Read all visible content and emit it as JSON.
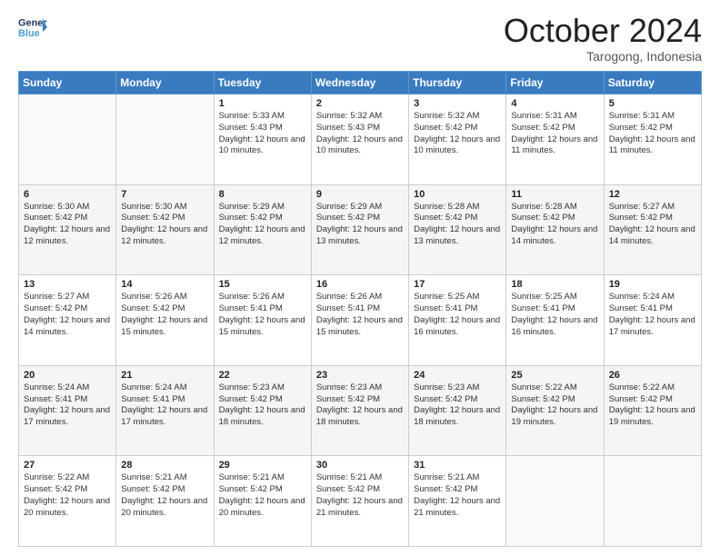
{
  "logo": {
    "line1": "General",
    "line2": "Blue"
  },
  "header": {
    "month": "October 2024",
    "location": "Tarogong, Indonesia"
  },
  "weekdays": [
    "Sunday",
    "Monday",
    "Tuesday",
    "Wednesday",
    "Thursday",
    "Friday",
    "Saturday"
  ],
  "weeks": [
    [
      {
        "day": "",
        "info": ""
      },
      {
        "day": "",
        "info": ""
      },
      {
        "day": "1",
        "info": "Sunrise: 5:33 AM\nSunset: 5:43 PM\nDaylight: 12 hours and 10 minutes."
      },
      {
        "day": "2",
        "info": "Sunrise: 5:32 AM\nSunset: 5:43 PM\nDaylight: 12 hours and 10 minutes."
      },
      {
        "day": "3",
        "info": "Sunrise: 5:32 AM\nSunset: 5:42 PM\nDaylight: 12 hours and 10 minutes."
      },
      {
        "day": "4",
        "info": "Sunrise: 5:31 AM\nSunset: 5:42 PM\nDaylight: 12 hours and 11 minutes."
      },
      {
        "day": "5",
        "info": "Sunrise: 5:31 AM\nSunset: 5:42 PM\nDaylight: 12 hours and 11 minutes."
      }
    ],
    [
      {
        "day": "6",
        "info": "Sunrise: 5:30 AM\nSunset: 5:42 PM\nDaylight: 12 hours and 12 minutes."
      },
      {
        "day": "7",
        "info": "Sunrise: 5:30 AM\nSunset: 5:42 PM\nDaylight: 12 hours and 12 minutes."
      },
      {
        "day": "8",
        "info": "Sunrise: 5:29 AM\nSunset: 5:42 PM\nDaylight: 12 hours and 12 minutes."
      },
      {
        "day": "9",
        "info": "Sunrise: 5:29 AM\nSunset: 5:42 PM\nDaylight: 12 hours and 13 minutes."
      },
      {
        "day": "10",
        "info": "Sunrise: 5:28 AM\nSunset: 5:42 PM\nDaylight: 12 hours and 13 minutes."
      },
      {
        "day": "11",
        "info": "Sunrise: 5:28 AM\nSunset: 5:42 PM\nDaylight: 12 hours and 14 minutes."
      },
      {
        "day": "12",
        "info": "Sunrise: 5:27 AM\nSunset: 5:42 PM\nDaylight: 12 hours and 14 minutes."
      }
    ],
    [
      {
        "day": "13",
        "info": "Sunrise: 5:27 AM\nSunset: 5:42 PM\nDaylight: 12 hours and 14 minutes."
      },
      {
        "day": "14",
        "info": "Sunrise: 5:26 AM\nSunset: 5:42 PM\nDaylight: 12 hours and 15 minutes."
      },
      {
        "day": "15",
        "info": "Sunrise: 5:26 AM\nSunset: 5:41 PM\nDaylight: 12 hours and 15 minutes."
      },
      {
        "day": "16",
        "info": "Sunrise: 5:26 AM\nSunset: 5:41 PM\nDaylight: 12 hours and 15 minutes."
      },
      {
        "day": "17",
        "info": "Sunrise: 5:25 AM\nSunset: 5:41 PM\nDaylight: 12 hours and 16 minutes."
      },
      {
        "day": "18",
        "info": "Sunrise: 5:25 AM\nSunset: 5:41 PM\nDaylight: 12 hours and 16 minutes."
      },
      {
        "day": "19",
        "info": "Sunrise: 5:24 AM\nSunset: 5:41 PM\nDaylight: 12 hours and 17 minutes."
      }
    ],
    [
      {
        "day": "20",
        "info": "Sunrise: 5:24 AM\nSunset: 5:41 PM\nDaylight: 12 hours and 17 minutes."
      },
      {
        "day": "21",
        "info": "Sunrise: 5:24 AM\nSunset: 5:41 PM\nDaylight: 12 hours and 17 minutes."
      },
      {
        "day": "22",
        "info": "Sunrise: 5:23 AM\nSunset: 5:42 PM\nDaylight: 12 hours and 18 minutes."
      },
      {
        "day": "23",
        "info": "Sunrise: 5:23 AM\nSunset: 5:42 PM\nDaylight: 12 hours and 18 minutes."
      },
      {
        "day": "24",
        "info": "Sunrise: 5:23 AM\nSunset: 5:42 PM\nDaylight: 12 hours and 18 minutes."
      },
      {
        "day": "25",
        "info": "Sunrise: 5:22 AM\nSunset: 5:42 PM\nDaylight: 12 hours and 19 minutes."
      },
      {
        "day": "26",
        "info": "Sunrise: 5:22 AM\nSunset: 5:42 PM\nDaylight: 12 hours and 19 minutes."
      }
    ],
    [
      {
        "day": "27",
        "info": "Sunrise: 5:22 AM\nSunset: 5:42 PM\nDaylight: 12 hours and 20 minutes."
      },
      {
        "day": "28",
        "info": "Sunrise: 5:21 AM\nSunset: 5:42 PM\nDaylight: 12 hours and 20 minutes."
      },
      {
        "day": "29",
        "info": "Sunrise: 5:21 AM\nSunset: 5:42 PM\nDaylight: 12 hours and 20 minutes."
      },
      {
        "day": "30",
        "info": "Sunrise: 5:21 AM\nSunset: 5:42 PM\nDaylight: 12 hours and 21 minutes."
      },
      {
        "day": "31",
        "info": "Sunrise: 5:21 AM\nSunset: 5:42 PM\nDaylight: 12 hours and 21 minutes."
      },
      {
        "day": "",
        "info": ""
      },
      {
        "day": "",
        "info": ""
      }
    ]
  ]
}
